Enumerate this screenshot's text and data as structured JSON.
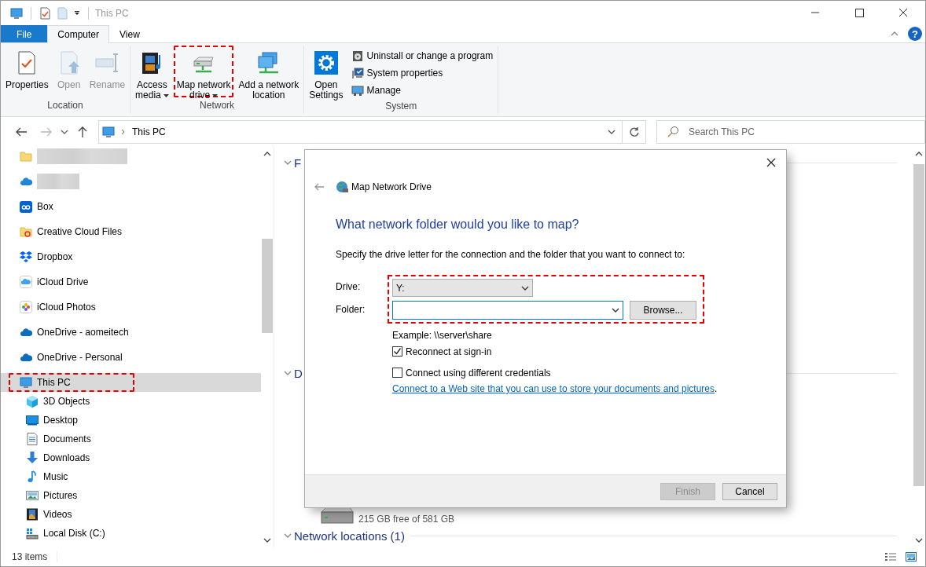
{
  "window": {
    "title": "This PC",
    "help": "?"
  },
  "ribbon_tabs": [
    {
      "label": "File",
      "kind": "file",
      "selected": false
    },
    {
      "label": "Computer",
      "kind": "tab",
      "selected": true
    },
    {
      "label": "View",
      "kind": "tab",
      "selected": false
    }
  ],
  "ribbon_groups": [
    {
      "label": "Location",
      "buttons": [
        {
          "lines": [
            "Properties"
          ],
          "disabled": false
        },
        {
          "lines": [
            "Open"
          ],
          "disabled": true
        },
        {
          "lines": [
            "Rename"
          ],
          "disabled": true
        }
      ]
    },
    {
      "label": "Network",
      "buttons": [
        {
          "lines": [
            "Access",
            "media"
          ],
          "disabled": false,
          "dropdown": true
        },
        {
          "lines": [
            "Map network",
            "drive"
          ],
          "disabled": false,
          "dropdown": true,
          "annotated": true
        },
        {
          "lines": [
            "Add a network",
            "location"
          ],
          "disabled": false
        }
      ]
    },
    {
      "label": "System",
      "buttons": [
        {
          "lines": [
            "Open",
            "Settings"
          ],
          "disabled": false
        }
      ],
      "small_buttons": [
        "Uninstall or change a program",
        "System properties",
        "Manage"
      ]
    }
  ],
  "address_bar": {
    "path": "This PC"
  },
  "search": {
    "placeholder": "Search This PC"
  },
  "nav": [
    {
      "kind": "blurred",
      "selected": false
    },
    {
      "kind": "blurred",
      "selected": false
    },
    {
      "kind": "item",
      "label": "Box",
      "selected": false
    },
    {
      "kind": "item",
      "label": "Creative Cloud Files",
      "selected": false
    },
    {
      "kind": "item",
      "label": "Dropbox",
      "selected": false
    },
    {
      "kind": "item",
      "label": "iCloud Drive",
      "selected": false
    },
    {
      "kind": "item",
      "label": "iCloud Photos",
      "selected": false
    },
    {
      "kind": "item",
      "label": "OneDrive - aomeitech",
      "selected": false
    },
    {
      "kind": "item",
      "label": "OneDrive - Personal",
      "selected": false
    },
    {
      "kind": "item",
      "label": "This PC",
      "selected": true,
      "annotated": true,
      "children": [
        {
          "label": "3D Objects",
          "selected": false
        },
        {
          "label": "Desktop",
          "selected": false
        },
        {
          "label": "Documents",
          "selected": false
        },
        {
          "label": "Downloads",
          "selected": false
        },
        {
          "label": "Music",
          "selected": false
        },
        {
          "label": "Pictures",
          "selected": false
        },
        {
          "label": "Videos",
          "selected": false
        },
        {
          "label": "Local Disk (C:)",
          "selected": false
        }
      ]
    }
  ],
  "sections": [
    {
      "title": "F"
    },
    {
      "title": "D",
      "drives": [
        {
          "free": "215 GB free of 581 GB"
        }
      ]
    },
    {
      "title": "Network locations (1)"
    }
  ],
  "dialog": {
    "title": "Map Network Drive",
    "heading": "What network folder would you like to map?",
    "instruction": "Specify the drive letter for the connection and the folder that you want to connect to:",
    "annotated": true,
    "fields": [
      {
        "label": "Drive:",
        "kind": "select",
        "value": "Y:",
        "focused": false
      },
      {
        "label": "Folder:",
        "kind": "combo",
        "focused": true,
        "button": "Browse..."
      }
    ],
    "example": "Example: \\\\server\\share",
    "checkboxes": [
      {
        "label": "Reconnect at sign-in",
        "checked": true
      },
      {
        "label": "Connect using different credentials",
        "checked": false
      }
    ],
    "link": {
      "text": "Connect to a Web site that you can use to store your documents and pictures",
      "after": "."
    },
    "buttons": [
      {
        "label": "Finish",
        "disabled": true
      },
      {
        "label": "Cancel",
        "disabled": false
      }
    ]
  },
  "status_bar": {
    "text": "13 items"
  }
}
